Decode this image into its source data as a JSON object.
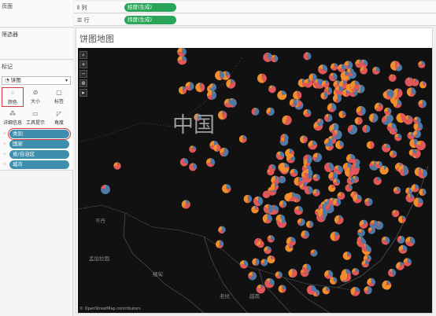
{
  "left_panels": {
    "pages_title": "页面",
    "filters_title": "筛选器",
    "marks_title": "标记",
    "mark_type": "饼图",
    "buttons": {
      "color": "颜色",
      "size": "大小",
      "label": "标签",
      "detail": "详细信息",
      "tooltip": "工具提示",
      "angle": "角度"
    },
    "fields": [
      {
        "glyph": "⁘",
        "label": "类别"
      },
      {
        "glyph": "⁘",
        "label": "国家"
      },
      {
        "glyph": "⁘",
        "label": "省/自治区"
      },
      {
        "glyph": "⁘",
        "label": "城市"
      }
    ]
  },
  "shelves": {
    "columns_label": "列",
    "columns_pill": "经度(生成)",
    "rows_label": "行",
    "rows_pill": "纬度(生成)"
  },
  "sheet": {
    "title": "饼图地图"
  },
  "map": {
    "country_label": "中国",
    "labels": [
      "不丹",
      "孟加拉国",
      "缅甸",
      "老挝",
      "越南"
    ],
    "attribution": "© OpenStreetMap contributors",
    "tools": [
      "⌕",
      "+",
      "−",
      "⊕",
      "▸"
    ],
    "background": "#111111",
    "pie_colors": [
      "#4e79a7",
      "#e15759",
      "#f28e2b"
    ]
  }
}
